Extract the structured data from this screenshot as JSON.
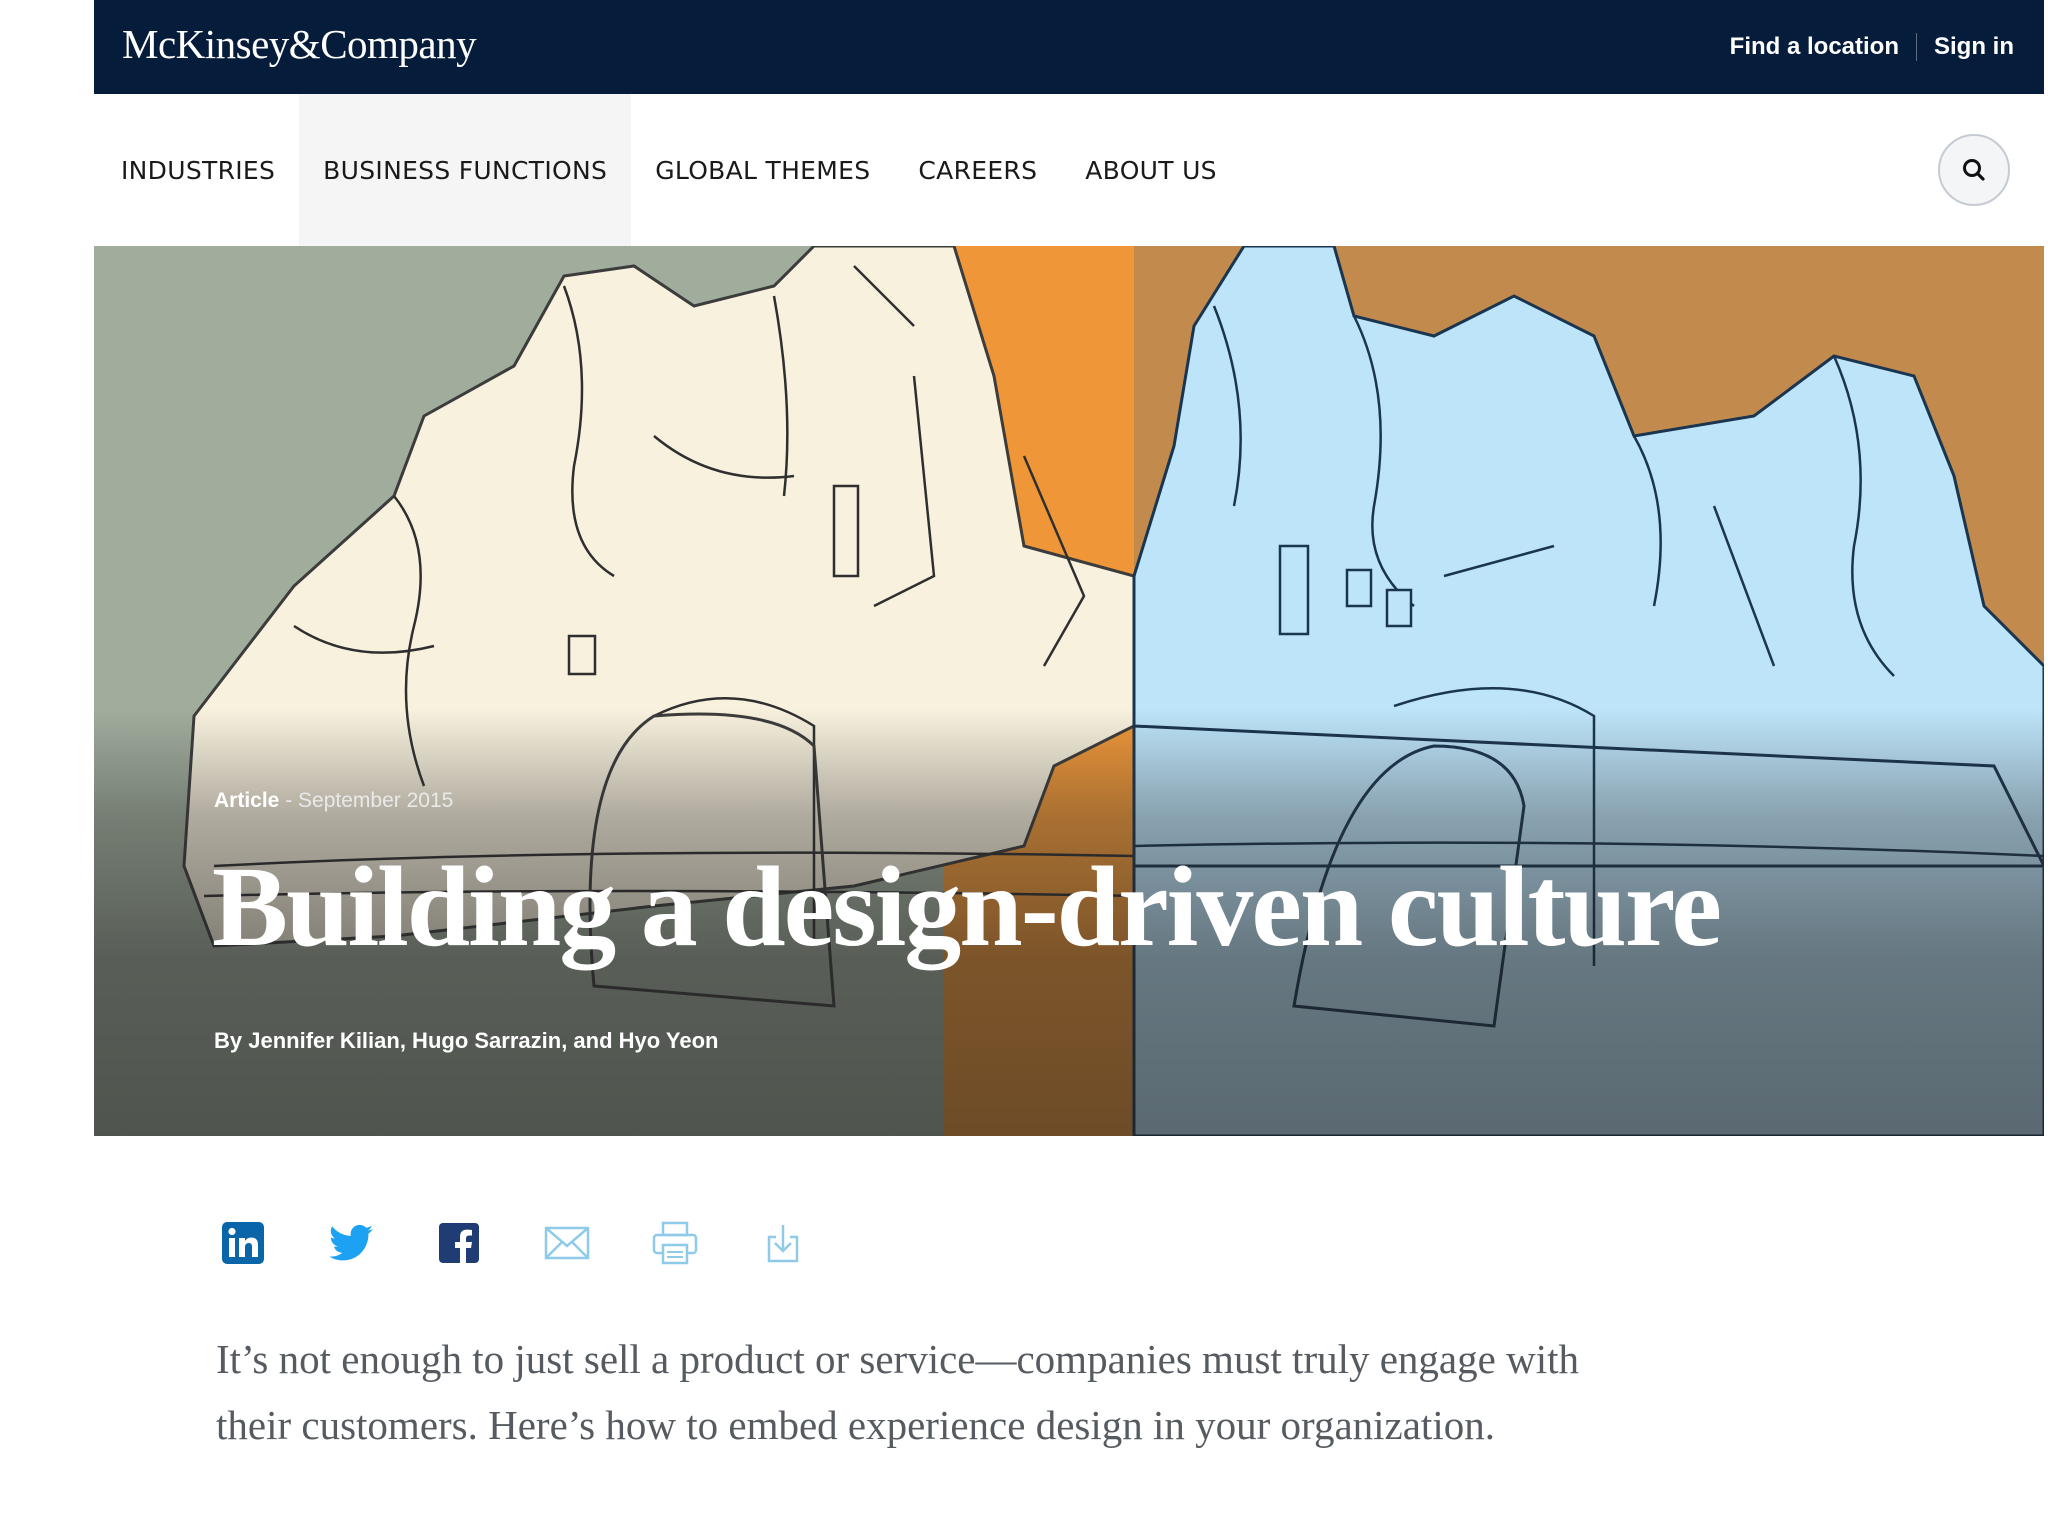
{
  "header": {
    "logo": "McKinsey&Company",
    "links": [
      "Find a location",
      "Sign in"
    ]
  },
  "nav": {
    "items": [
      "INDUSTRIES",
      "BUSINESS FUNCTIONS",
      "GLOBAL THEMES",
      "CAREERS",
      "ABOUT US"
    ],
    "active_item": "BUSINESS FUNCTIONS",
    "search_icon": "search-icon"
  },
  "hero": {
    "meta_type": "Article",
    "meta_separator": " - ",
    "meta_date": "September 2015",
    "title": "Building a design-driven culture",
    "authors": "By Jennifer Kilian, Hugo Sarrazin, and Hyo Yeon"
  },
  "share": {
    "icons": [
      "linkedin-icon",
      "twitter-icon",
      "facebook-icon",
      "email-icon",
      "print-icon",
      "download-icon"
    ]
  },
  "summary": "It’s not enough to just sell a product or service—companies must truly engage with their customers. Here’s how to embed experience design in your organization.",
  "colors": {
    "header_bg": "#051c3b",
    "nav_active_bg": "#f5f5f6",
    "hero_left_bg": "#a0ad9d",
    "hero_orange": "#ef9738",
    "hero_brown": "#c28a4d",
    "hero_blue": "#bde4f9",
    "hero_cream": "#f8f1de",
    "summary_text": "#555b60",
    "linkedin": "#0a66a8",
    "twitter": "#1da1f2",
    "facebook": "#1f3c74",
    "light_icon": "#8fcbe8"
  }
}
